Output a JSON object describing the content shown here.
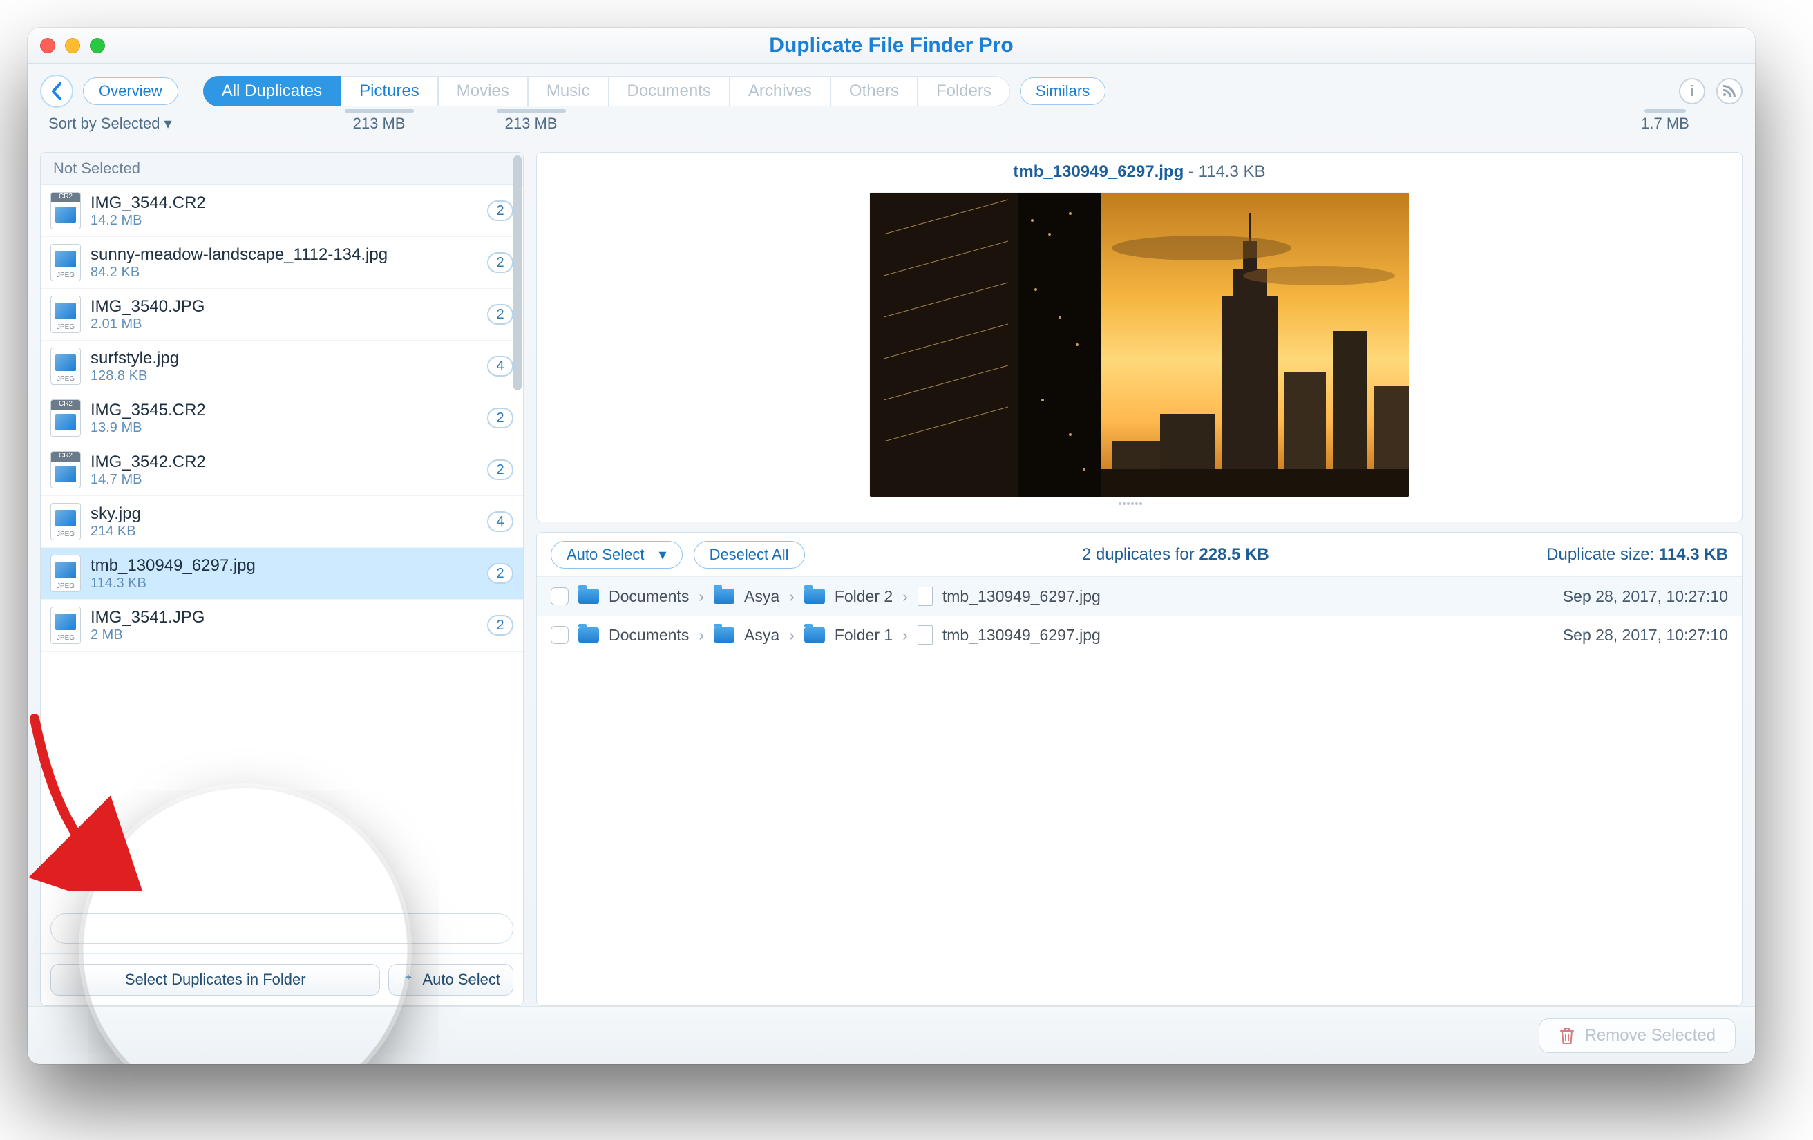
{
  "title": "Duplicate File Finder Pro",
  "toolbar": {
    "overview": "Overview",
    "all": "All Duplicates",
    "pictures": "Pictures",
    "movies": "Movies",
    "music": "Music",
    "documents": "Documents",
    "archives": "Archives",
    "others": "Others",
    "folders": "Folders",
    "similars": "Similars"
  },
  "sort_label": "Sort by Selected ▾",
  "sizes": {
    "cat1": "213 MB",
    "cat2": "213 MB",
    "similars": "1.7 MB"
  },
  "sidebar": {
    "section": "Not Selected",
    "items": [
      {
        "name": "IMG_3544.CR2",
        "size": "14.2 MB",
        "count": "2",
        "type": "cr2"
      },
      {
        "name": "sunny-meadow-landscape_1112-134.jpg",
        "size": "84.2 KB",
        "count": "2",
        "type": "jpeg"
      },
      {
        "name": "IMG_3540.JPG",
        "size": "2.01 MB",
        "count": "2",
        "type": "jpeg"
      },
      {
        "name": "surfstyle.jpg",
        "size": "128.8 KB",
        "count": "4",
        "type": "jpeg"
      },
      {
        "name": "IMG_3545.CR2",
        "size": "13.9 MB",
        "count": "2",
        "type": "cr2"
      },
      {
        "name": "IMG_3542.CR2",
        "size": "14.7 MB",
        "count": "2",
        "type": "cr2"
      },
      {
        "name": "sky.jpg",
        "size": "214 KB",
        "count": "4",
        "type": "jpeg"
      },
      {
        "name": "tmb_130949_6297.jpg",
        "size": "114.3 KB",
        "count": "2",
        "type": "jpeg",
        "selected": true
      },
      {
        "name": "IMG_3541.JPG",
        "size": "2 MB",
        "count": "2",
        "type": "jpeg"
      }
    ],
    "select_in_folder": "Select Duplicates in Folder",
    "auto_select": "Auto Select"
  },
  "preview": {
    "filename": "tmb_130949_6297.jpg",
    "size": "114.3 KB"
  },
  "dup": {
    "auto_select": "Auto Select",
    "deselect": "Deselect All",
    "count_text_a": "2 duplicates for ",
    "count_text_b": "228.5 KB",
    "size_label": "Duplicate size: ",
    "size_value": "114.3 KB",
    "rows": [
      {
        "path": [
          "Documents",
          "Asya",
          "Folder 2",
          "tmb_130949_6297.jpg"
        ],
        "date": "Sep 28, 2017, 10:27:10"
      },
      {
        "path": [
          "Documents",
          "Asya",
          "Folder 1",
          "tmb_130949_6297.jpg"
        ],
        "date": "Sep 28, 2017, 10:27:10"
      }
    ]
  },
  "footer": {
    "remove": "Remove Selected"
  }
}
